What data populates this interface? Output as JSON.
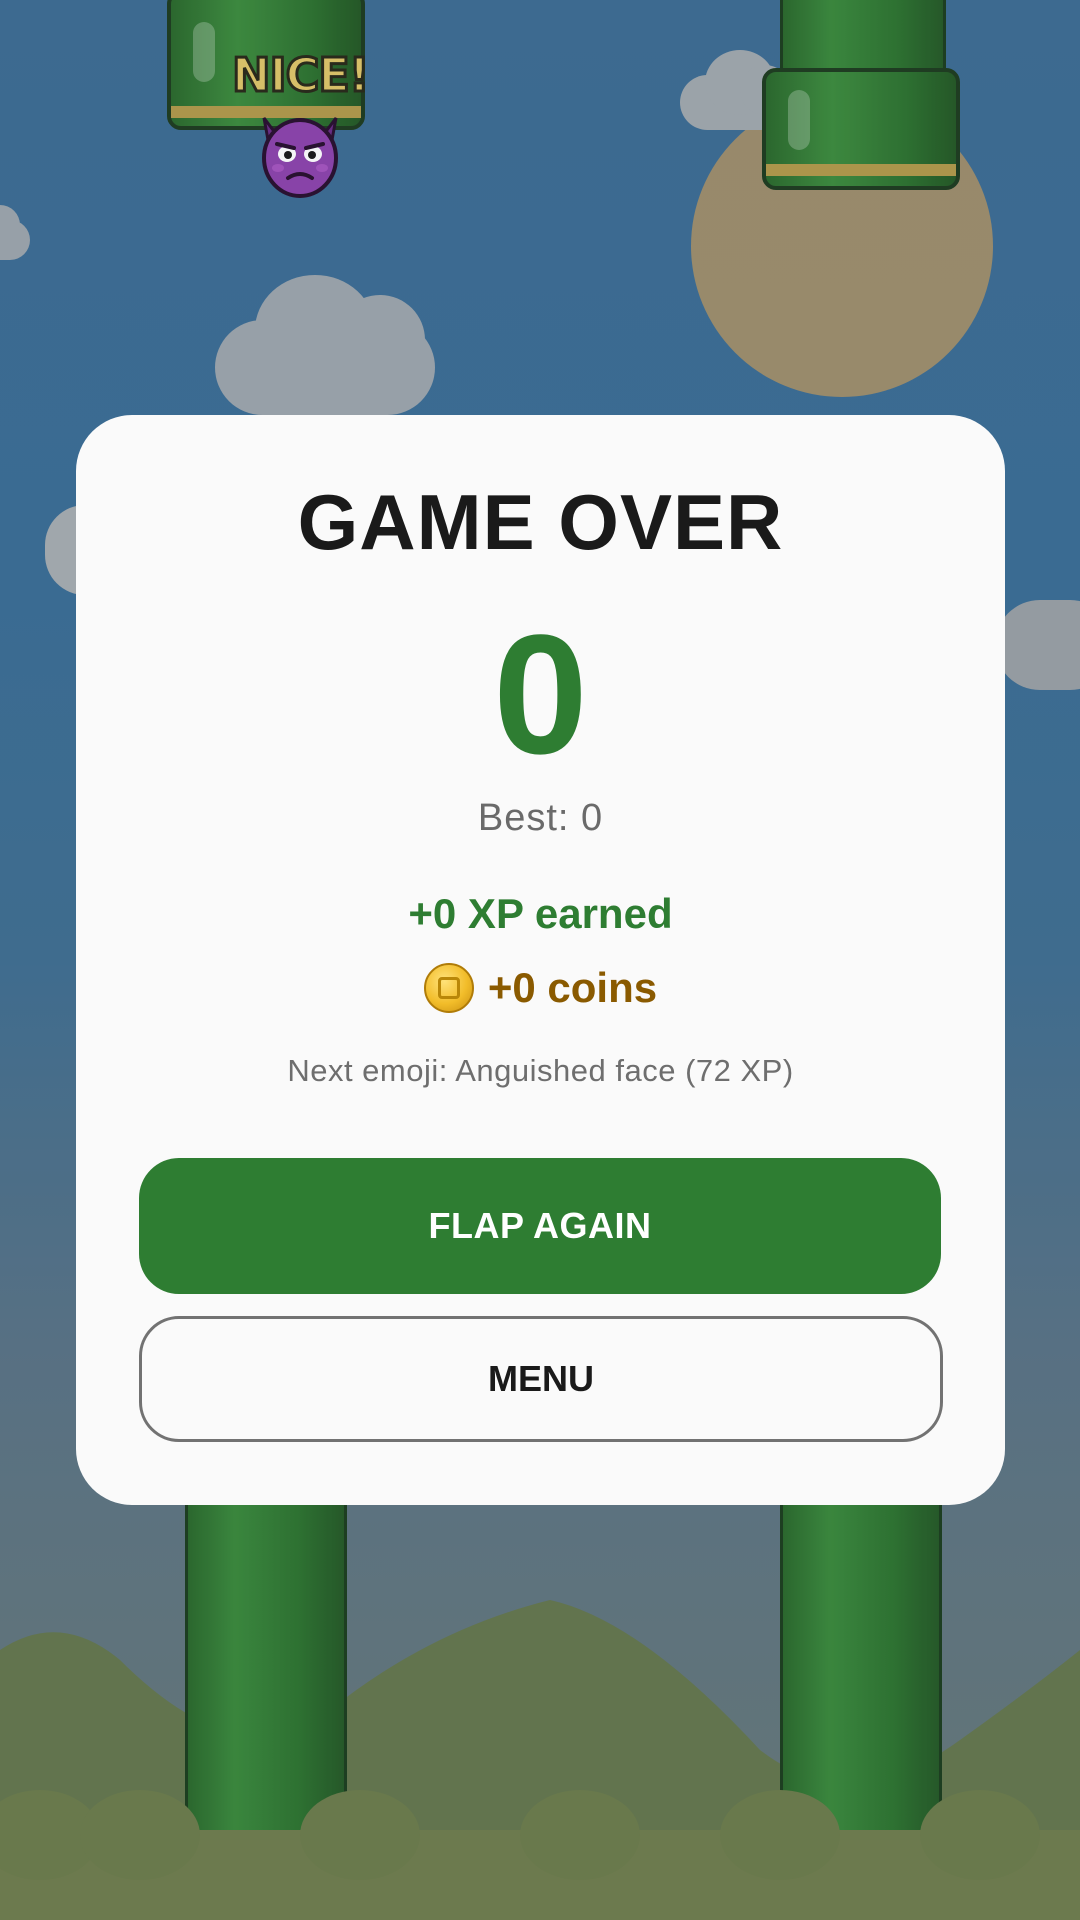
{
  "game": {
    "popup_text": "NICE!",
    "player_icon": "purple-devil-emoji"
  },
  "game_over_card": {
    "title": "GAME OVER",
    "score": "0",
    "best": "Best: 0",
    "xp_earned": "+0 XP earned",
    "coins": "+0 coins",
    "coin_icon": "coin-icon",
    "next_emoji": "Next emoji: Anguished face (72 XP)",
    "primary_button": "FLAP AGAIN",
    "secondary_button": "MENU"
  },
  "colors": {
    "accent_green": "#2e7d32",
    "coin_brown": "#8a5a00",
    "card_bg": "#fafafa",
    "pipe_green": "#2f7531"
  }
}
